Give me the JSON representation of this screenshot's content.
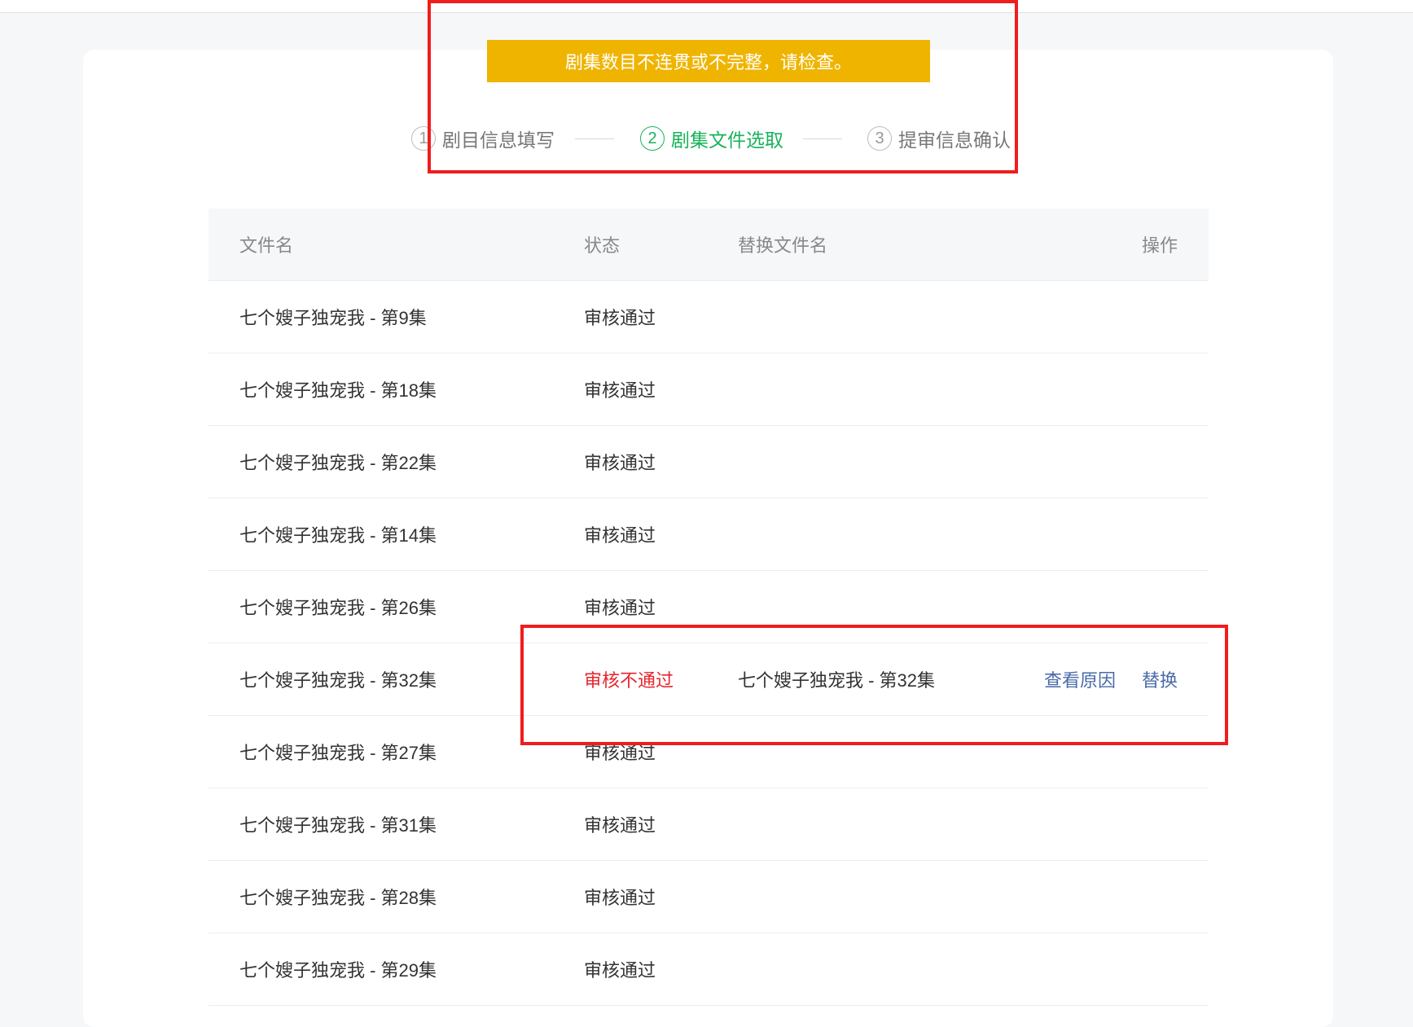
{
  "warning": "剧集数目不连贯或不完整，请检查。",
  "steps": [
    {
      "num": "1",
      "label": "剧目信息填写"
    },
    {
      "num": "2",
      "label": "剧集文件选取"
    },
    {
      "num": "3",
      "label": "提审信息确认"
    }
  ],
  "table": {
    "headers": {
      "filename": "文件名",
      "status": "状态",
      "replace_name": "替换文件名",
      "actions": "操作"
    },
    "rows": [
      {
        "filename": "七个嫂子独宠我 - 第9集",
        "status": "审核通过",
        "replace_name": ""
      },
      {
        "filename": "七个嫂子独宠我 - 第18集",
        "status": "审核通过",
        "replace_name": ""
      },
      {
        "filename": "七个嫂子独宠我 - 第22集",
        "status": "审核通过",
        "replace_name": ""
      },
      {
        "filename": "七个嫂子独宠我 - 第14集",
        "status": "审核通过",
        "replace_name": ""
      },
      {
        "filename": "七个嫂子独宠我 - 第26集",
        "status": "审核通过",
        "replace_name": ""
      },
      {
        "filename": "七个嫂子独宠我 - 第32集",
        "status": "审核不通过",
        "replace_name": "七个嫂子独宠我 - 第32集",
        "view_reason": "查看原因",
        "replace": "替换"
      },
      {
        "filename": "七个嫂子独宠我 - 第27集",
        "status": "审核通过",
        "replace_name": ""
      },
      {
        "filename": "七个嫂子独宠我 - 第31集",
        "status": "审核通过",
        "replace_name": ""
      },
      {
        "filename": "七个嫂子独宠我 - 第28集",
        "status": "审核通过",
        "replace_name": ""
      },
      {
        "filename": "七个嫂子独宠我 - 第29集",
        "status": "审核通过",
        "replace_name": ""
      }
    ]
  },
  "colors": {
    "warning_bg": "#efb400",
    "active_step": "#17b35a",
    "fail_status": "#e6262e",
    "link": "#4a6aa8",
    "highlight_box": "#f01d1d"
  }
}
